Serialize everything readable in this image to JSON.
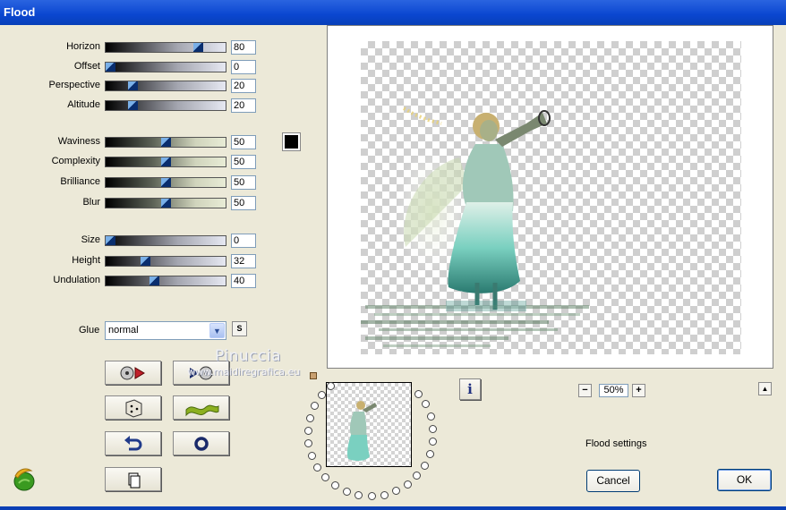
{
  "window": {
    "title": "Flood"
  },
  "params_group1": [
    {
      "label": "Horizon",
      "value": "80",
      "fraction": 0.8
    },
    {
      "label": "Offset",
      "value": "0",
      "fraction": 0.0
    },
    {
      "label": "Perspective",
      "value": "20",
      "fraction": 0.2
    },
    {
      "label": "Altitude",
      "value": "20",
      "fraction": 0.2
    }
  ],
  "params_group2": [
    {
      "label": "Waviness",
      "value": "50",
      "fraction": 0.5
    },
    {
      "label": "Complexity",
      "value": "50",
      "fraction": 0.5
    },
    {
      "label": "Brilliance",
      "value": "50",
      "fraction": 0.5
    },
    {
      "label": "Blur",
      "value": "50",
      "fraction": 0.5
    }
  ],
  "params_group3": [
    {
      "label": "Size",
      "value": "0",
      "fraction": 0.0
    },
    {
      "label": "Height",
      "value": "32",
      "fraction": 0.32
    },
    {
      "label": "Undulation",
      "value": "40",
      "fraction": 0.4
    }
  ],
  "color_swatch": "#000000",
  "glue": {
    "label": "Glue",
    "selected": "normal",
    "s_button": "S"
  },
  "watermark": {
    "line1": "Pinuccia",
    "line2": "www.maidiregrafica.eu"
  },
  "preview": {
    "zoom_minus": "−",
    "zoom_value": "50%",
    "zoom_plus": "+",
    "collapse": "▲",
    "info": "i"
  },
  "settings_label": "Flood settings",
  "buttons": {
    "cancel": "Cancel",
    "ok": "OK"
  },
  "accent": "#0a46d0"
}
